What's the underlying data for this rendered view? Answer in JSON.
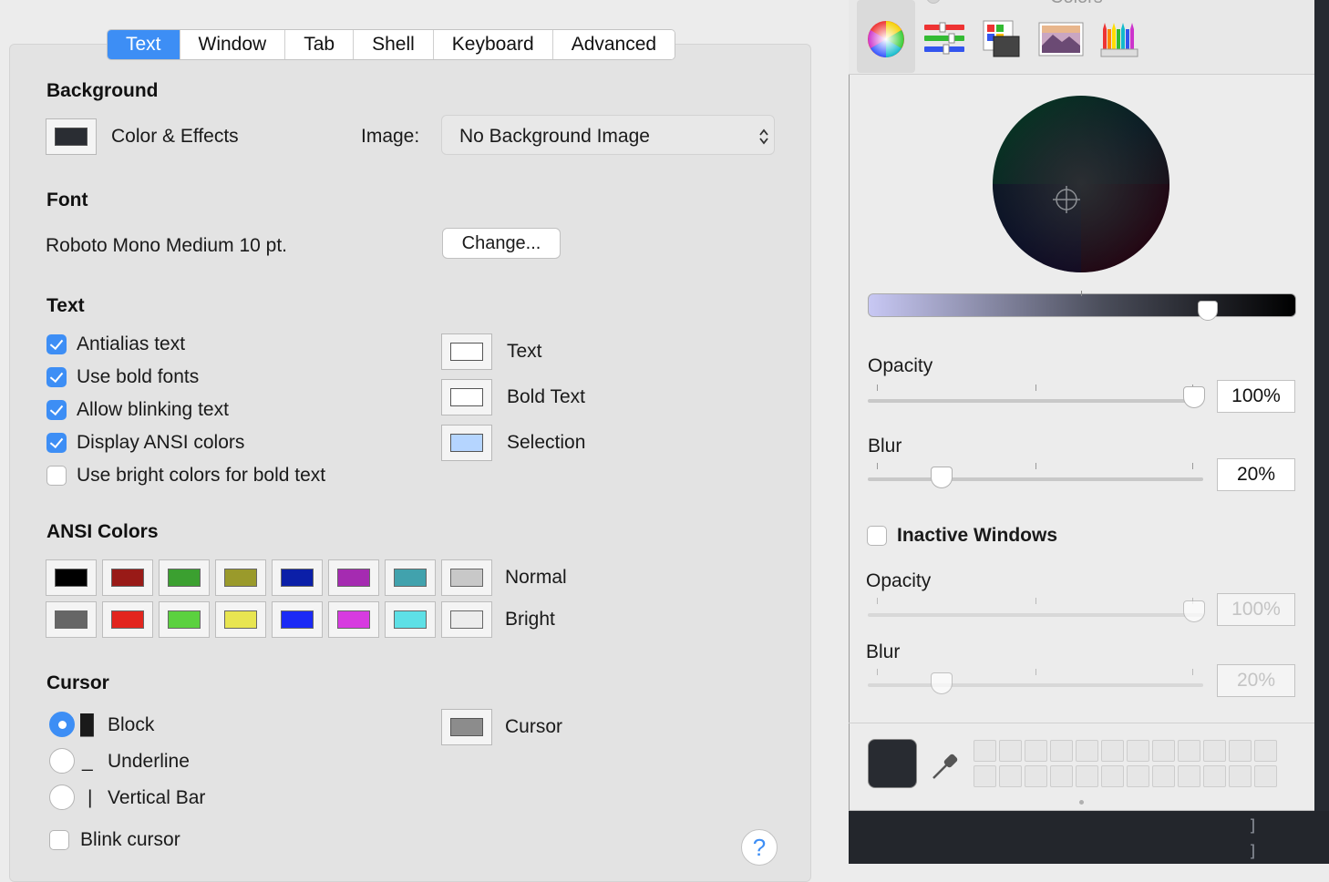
{
  "tabs": [
    "Text",
    "Window",
    "Tab",
    "Shell",
    "Keyboard",
    "Advanced"
  ],
  "active_tab": "Text",
  "background": {
    "title": "Background",
    "color_effects_label": "Color & Effects",
    "image_label": "Image:",
    "image_value": "No Background Image",
    "swatch_color": "#2a2d33"
  },
  "font": {
    "title": "Font",
    "value": "Roboto Mono Medium 10 pt.",
    "change_label": "Change..."
  },
  "text_section": {
    "title": "Text",
    "checkboxes": [
      {
        "label": "Antialias text",
        "checked": true
      },
      {
        "label": "Use bold fonts",
        "checked": true
      },
      {
        "label": "Allow blinking text",
        "checked": true
      },
      {
        "label": "Display ANSI colors",
        "checked": true
      },
      {
        "label": "Use bright colors for bold text",
        "checked": false
      }
    ],
    "wells": [
      {
        "label": "Text",
        "color": "#ffffff"
      },
      {
        "label": "Bold Text",
        "color": "#ffffff"
      },
      {
        "label": "Selection",
        "color": "#b5d5ff"
      }
    ]
  },
  "ansi": {
    "title": "ANSI Colors",
    "normal_label": "Normal",
    "bright_label": "Bright",
    "normal": [
      "#000000",
      "#991a17",
      "#3ba030",
      "#9a9a2b",
      "#0b1fa8",
      "#a52bb1",
      "#41a2ad",
      "#c8c8c8"
    ],
    "bright": [
      "#666666",
      "#e2251e",
      "#5bd13f",
      "#e8e551",
      "#1b2af5",
      "#d73be0",
      "#5ee0e6",
      "#ececec"
    ]
  },
  "cursor": {
    "title": "Cursor",
    "options": [
      {
        "glyph": "█",
        "label": "Block",
        "selected": true
      },
      {
        "glyph": "_",
        "label": "Underline",
        "selected": false
      },
      {
        "glyph": "|",
        "label": "Vertical Bar",
        "selected": false
      }
    ],
    "blink_label": "Blink cursor",
    "well_label": "Cursor",
    "well_color": "#8c8c8c"
  },
  "help_label": "?",
  "colors_panel": {
    "title": "Colors",
    "toolbar_icons": [
      "color-wheel-icon",
      "color-sliders-icon",
      "color-palettes-icon",
      "image-palettes-icon",
      "pencils-icon"
    ],
    "brightness_level": 0.81,
    "opacity_label": "Opacity",
    "opacity_value": "100%",
    "opacity_level": 1.0,
    "blur_label": "Blur",
    "blur_value": "20%",
    "blur_level": 0.2,
    "inactive_label": "Inactive Windows",
    "inactive_checked": false,
    "inactive_opacity_label": "Opacity",
    "inactive_opacity_value": "100%",
    "inactive_blur_label": "Blur",
    "inactive_blur_value": "20%",
    "current_color": "#282b31"
  },
  "terminal_glyph": "]"
}
